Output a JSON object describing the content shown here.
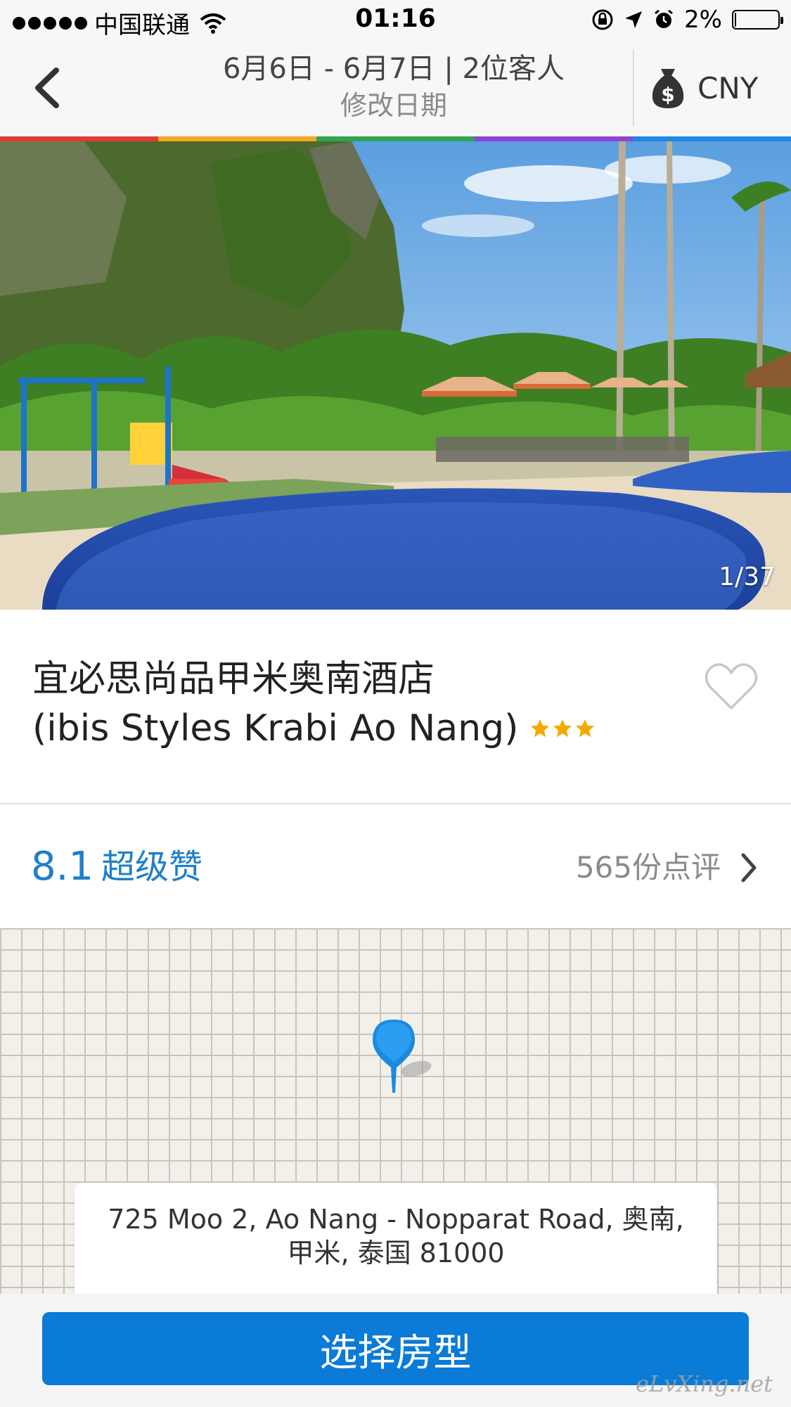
{
  "status_bar": {
    "carrier": "中国联通",
    "time": "01:16",
    "battery_percent": "2%",
    "battery_level": 0.02
  },
  "header": {
    "dates_guests": "6月6日 - 6月7日 | 2位客人",
    "edit_dates": "修改日期",
    "currency": "CNY"
  },
  "stripe_colors": [
    "#e53935",
    "#f5a623",
    "#2ea44f",
    "#8e44d6",
    "#1e88e5"
  ],
  "hero": {
    "photo_counter": "1/37"
  },
  "hotel": {
    "name_cn": "宜必思尚品甲米奥南酒店",
    "name_en": "(ibis Styles Krabi Ao Nang)",
    "stars": 3,
    "star_color": "#f5a900"
  },
  "rating": {
    "score": "8.1",
    "label": "超级赞",
    "reviews": "565份点评"
  },
  "address": {
    "line1": "725 Moo 2, Ao Nang - Nopparat Road, 奥南,",
    "line2": "甲米, 泰国 81000"
  },
  "cta": {
    "label": "选择房型"
  },
  "watermark": "eLvXing.net",
  "icons": {
    "back": "chevron-left-icon",
    "currency": "money-bag-icon",
    "favorite": "heart-outline-icon",
    "rating_arrow": "chevron-right-icon",
    "map_pin": "map-pin-icon"
  },
  "colors": {
    "accent": "#0a7bd6",
    "rating": "#1f7fc9"
  }
}
